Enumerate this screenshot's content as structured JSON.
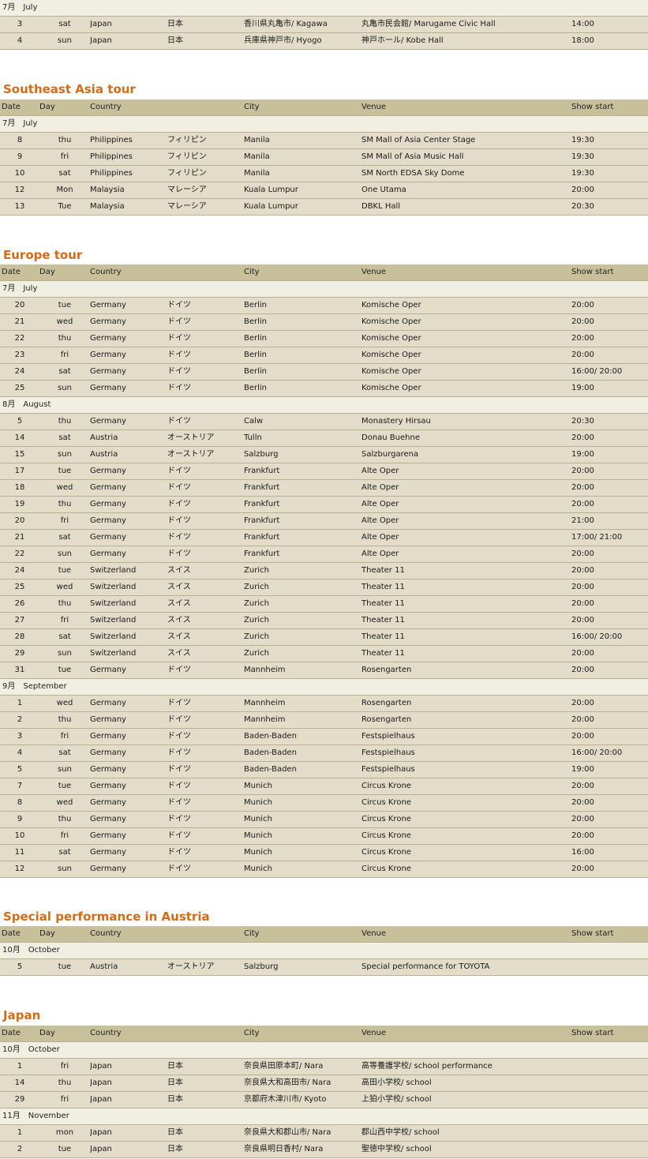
{
  "header_labels": {
    "date": "Date",
    "day": "Day",
    "country": "Country",
    "city": "City",
    "venue": "Venue",
    "show": "Show start"
  },
  "sections": [
    {
      "title": "",
      "months": [
        {
          "jp": "7月",
          "en": "July",
          "rows": [
            {
              "date": "3",
              "day": "sat",
              "country": "Japan",
              "country_jp": "日本",
              "city": "香川県丸亀市/ Kagawa",
              "venue": "丸亀市民会館/ Marugame Civic Hall",
              "time": "14:00"
            },
            {
              "date": "4",
              "day": "sun",
              "country": "Japan",
              "country_jp": "日本",
              "city": "兵庫県神戸市/ Hyogo",
              "venue": "神戸ホール/ Kobe Hall",
              "time": "18:00"
            }
          ]
        }
      ]
    },
    {
      "title": "Southeast Asia tour",
      "months": [
        {
          "jp": "7月",
          "en": "July",
          "rows": [
            {
              "date": "8",
              "day": "thu",
              "country": "Philippines",
              "country_jp": "フィリピン",
              "city": "Manila",
              "venue": "SM Mall of Asia Center Stage",
              "time": "19:30"
            },
            {
              "date": "9",
              "day": "fri",
              "country": "Philippines",
              "country_jp": "フィリピン",
              "city": "Manila",
              "venue": "SM Mall of Asia Music Hall",
              "time": "19:30"
            },
            {
              "date": "10",
              "day": "sat",
              "country": "Philippines",
              "country_jp": "フィリピン",
              "city": "Manila",
              "venue": "SM North EDSA Sky Dome",
              "time": "19:30"
            },
            {
              "date": "12",
              "day": "Mon",
              "country": "Malaysia",
              "country_jp": "マレーシア",
              "city": "Kuala Lumpur",
              "venue": "One Utama",
              "time": "20:00"
            },
            {
              "date": "13",
              "day": "Tue",
              "country": "Malaysia",
              "country_jp": "マレーシア",
              "city": "Kuala Lumpur",
              "venue": "DBKL Hall",
              "time": "20:30"
            }
          ]
        }
      ]
    },
    {
      "title": "Europe tour",
      "months": [
        {
          "jp": "7月",
          "en": "July",
          "rows": [
            {
              "date": "20",
              "day": "tue",
              "country": "Germany",
              "country_jp": "ドイツ",
              "city": "Berlin",
              "venue": "Komische Oper",
              "time": "20:00"
            },
            {
              "date": "21",
              "day": "wed",
              "country": "Germany",
              "country_jp": "ドイツ",
              "city": "Berlin",
              "venue": "Komische Oper",
              "time": "20:00"
            },
            {
              "date": "22",
              "day": "thu",
              "country": "Germany",
              "country_jp": "ドイツ",
              "city": "Berlin",
              "venue": "Komische Oper",
              "time": "20:00"
            },
            {
              "date": "23",
              "day": "fri",
              "country": "Germany",
              "country_jp": "ドイツ",
              "city": "Berlin",
              "venue": "Komische Oper",
              "time": "20:00"
            },
            {
              "date": "24",
              "day": "sat",
              "country": "Germany",
              "country_jp": "ドイツ",
              "city": "Berlin",
              "venue": "Komische Oper",
              "time": "16:00/ 20:00"
            },
            {
              "date": "25",
              "day": "sun",
              "country": "Germany",
              "country_jp": "ドイツ",
              "city": "Berlin",
              "venue": "Komische Oper",
              "time": "19:00"
            }
          ]
        },
        {
          "jp": "8月",
          "en": "August",
          "rows": [
            {
              "date": "5",
              "day": "thu",
              "country": "Germany",
              "country_jp": "ドイツ",
              "city": "Calw",
              "venue": "Monastery Hirsau",
              "time": "20:30"
            },
            {
              "date": "14",
              "day": "sat",
              "country": "Austria",
              "country_jp": "オーストリア",
              "city": "Tulln",
              "venue": "Donau Buehne",
              "time": "20:00"
            },
            {
              "date": "15",
              "day": "sun",
              "country": "Austria",
              "country_jp": "オーストリア",
              "city": "Salzburg",
              "venue": "Salzburgarena",
              "time": "19:00"
            },
            {
              "date": "17",
              "day": "tue",
              "country": "Germany",
              "country_jp": "ドイツ",
              "city": "Frankfurt",
              "venue": "Alte Oper",
              "time": "20:00"
            },
            {
              "date": "18",
              "day": "wed",
              "country": "Germany",
              "country_jp": "ドイツ",
              "city": "Frankfurt",
              "venue": "Alte Oper",
              "time": "20:00"
            },
            {
              "date": "19",
              "day": "thu",
              "country": "Germany",
              "country_jp": "ドイツ",
              "city": "Frankfurt",
              "venue": "Alte Oper",
              "time": "20:00"
            },
            {
              "date": "20",
              "day": "fri",
              "country": "Germany",
              "country_jp": "ドイツ",
              "city": "Frankfurt",
              "venue": "Alte Oper",
              "time": "21:00"
            },
            {
              "date": "21",
              "day": "sat",
              "country": "Germany",
              "country_jp": "ドイツ",
              "city": "Frankfurt",
              "venue": "Alte Oper",
              "time": "17:00/ 21:00"
            },
            {
              "date": "22",
              "day": "sun",
              "country": "Germany",
              "country_jp": "ドイツ",
              "city": "Frankfurt",
              "venue": "Alte Oper",
              "time": "20:00"
            },
            {
              "date": "24",
              "day": "tue",
              "country": "Switzerland",
              "country_jp": "スイス",
              "city": "Zurich",
              "venue": "Theater 11",
              "time": "20:00"
            },
            {
              "date": "25",
              "day": "wed",
              "country": "Switzerland",
              "country_jp": "スイス",
              "city": "Zurich",
              "venue": "Theater 11",
              "time": "20:00"
            },
            {
              "date": "26",
              "day": "thu",
              "country": "Switzerland",
              "country_jp": "スイス",
              "city": "Zurich",
              "venue": "Theater 11",
              "time": "20:00"
            },
            {
              "date": "27",
              "day": "fri",
              "country": "Switzerland",
              "country_jp": "スイス",
              "city": "Zurich",
              "venue": "Theater 11",
              "time": "20:00"
            },
            {
              "date": "28",
              "day": "sat",
              "country": "Switzerland",
              "country_jp": "スイス",
              "city": "Zurich",
              "venue": "Theater 11",
              "time": "16:00/ 20:00"
            },
            {
              "date": "29",
              "day": "sun",
              "country": "Switzerland",
              "country_jp": "スイス",
              "city": "Zurich",
              "venue": "Theater 11",
              "time": "20:00"
            },
            {
              "date": "31",
              "day": "tue",
              "country": "Germany",
              "country_jp": "ドイツ",
              "city": "Mannheim",
              "venue": "Rosengarten",
              "time": "20:00"
            }
          ]
        },
        {
          "jp": "9月",
          "en": "September",
          "rows": [
            {
              "date": "1",
              "day": "wed",
              "country": "Germany",
              "country_jp": "ドイツ",
              "city": "Mannheim",
              "venue": "Rosengarten",
              "time": "20:00"
            },
            {
              "date": "2",
              "day": "thu",
              "country": "Germany",
              "country_jp": "ドイツ",
              "city": "Mannheim",
              "venue": "Rosengarten",
              "time": "20:00"
            },
            {
              "date": "3",
              "day": "fri",
              "country": "Germany",
              "country_jp": "ドイツ",
              "city": "Baden-Baden",
              "venue": "Festspielhaus",
              "time": "20:00"
            },
            {
              "date": "4",
              "day": "sat",
              "country": "Germany",
              "country_jp": "ドイツ",
              "city": "Baden-Baden",
              "venue": "Festspielhaus",
              "time": "16:00/ 20:00"
            },
            {
              "date": "5",
              "day": "sun",
              "country": "Germany",
              "country_jp": "ドイツ",
              "city": "Baden-Baden",
              "venue": "Festspielhaus",
              "time": "19:00"
            },
            {
              "date": "7",
              "day": "tue",
              "country": "Germany",
              "country_jp": "ドイツ",
              "city": "Munich",
              "venue": "Circus Krone",
              "time": "20:00"
            },
            {
              "date": "8",
              "day": "wed",
              "country": "Germany",
              "country_jp": "ドイツ",
              "city": "Munich",
              "venue": "Circus Krone",
              "time": "20:00"
            },
            {
              "date": "9",
              "day": "thu",
              "country": "Germany",
              "country_jp": "ドイツ",
              "city": "Munich",
              "venue": "Circus Krone",
              "time": "20:00"
            },
            {
              "date": "10",
              "day": "fri",
              "country": "Germany",
              "country_jp": "ドイツ",
              "city": "Munich",
              "venue": "Circus Krone",
              "time": "20:00"
            },
            {
              "date": "11",
              "day": "sat",
              "country": "Germany",
              "country_jp": "ドイツ",
              "city": "Munich",
              "venue": "Circus Krone",
              "time": "16:00"
            },
            {
              "date": "12",
              "day": "sun",
              "country": "Germany",
              "country_jp": "ドイツ",
              "city": "Munich",
              "venue": "Circus Krone",
              "time": "20:00"
            }
          ]
        }
      ]
    },
    {
      "title": "Special performance in Austria",
      "months": [
        {
          "jp": "10月",
          "en": "October",
          "rows": [
            {
              "date": "5",
              "day": "tue",
              "country": "Austria",
              "country_jp": "オーストリア",
              "city": "Salzburg",
              "venue": "Special performance for TOYOTA",
              "time": ""
            }
          ]
        }
      ]
    },
    {
      "title": "Japan",
      "months": [
        {
          "jp": "10月",
          "en": "October",
          "rows": [
            {
              "date": "1",
              "day": "fri",
              "country": "Japan",
              "country_jp": "日本",
              "city": "奈良県田原本町/ Nara",
              "venue": "高等養護学校/ school performance",
              "time": ""
            },
            {
              "date": "14",
              "day": "thu",
              "country": "Japan",
              "country_jp": "日本",
              "city": "奈良県大和高田市/ Nara",
              "venue": "高田小学校/ school",
              "time": ""
            },
            {
              "date": "29",
              "day": "fri",
              "country": "Japan",
              "country_jp": "日本",
              "city": "京都府木津川市/ Kyoto",
              "venue": "上狛小学校/ school",
              "time": ""
            }
          ]
        },
        {
          "jp": "11月",
          "en": "November",
          "rows": [
            {
              "date": "1",
              "day": "mon",
              "country": "Japan",
              "country_jp": "日本",
              "city": "奈良県大和郡山市/ Nara",
              "venue": "郡山西中学校/ school",
              "time": ""
            },
            {
              "date": "2",
              "day": "tue",
              "country": "Japan",
              "country_jp": "日本",
              "city": "奈良県明日香村/ Nara",
              "venue": "聖徳中学校/ school",
              "time": ""
            }
          ]
        }
      ]
    }
  ]
}
